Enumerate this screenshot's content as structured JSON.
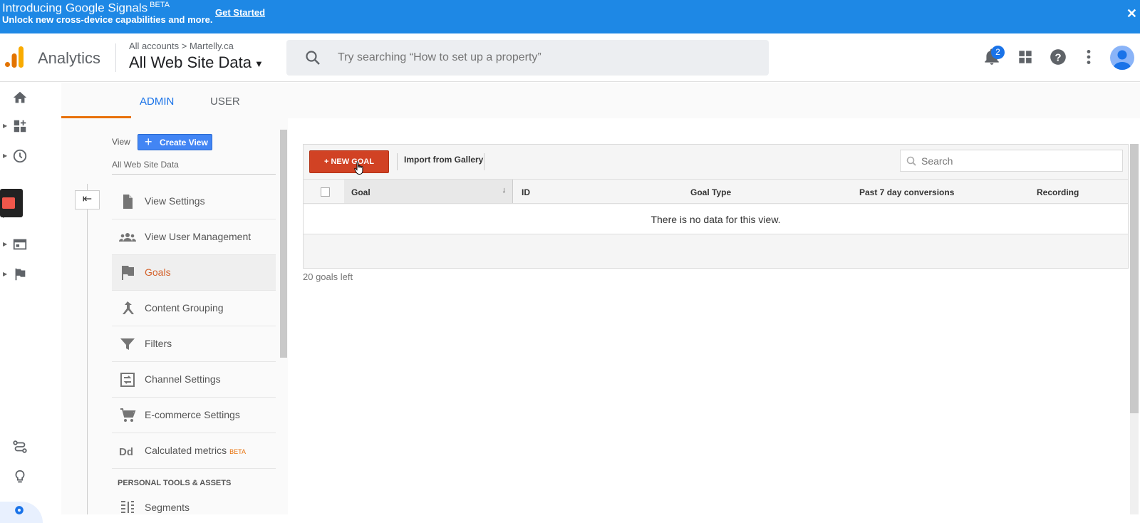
{
  "banner": {
    "title": "Introducing Google Signals",
    "title_sup": "BETA",
    "subtitle": "Unlock new cross-device capabilities and more.",
    "link": "Get Started",
    "close": "✕"
  },
  "header": {
    "app_name": "Analytics",
    "breadcrumb_accounts": "All accounts",
    "breadcrumb_sep": ">",
    "breadcrumb_account": "Martelly.ca",
    "property": "All Web Site Data",
    "search_placeholder": "Try searching “How to set up a property”",
    "notification_count": "2"
  },
  "tabs": {
    "admin": "ADMIN",
    "user": "USER"
  },
  "view_panel": {
    "view_label": "View",
    "create_view": "Create View",
    "view_name": "All Web Site Data",
    "items": [
      {
        "label": "View Settings"
      },
      {
        "label": "View User Management"
      },
      {
        "label": "Goals"
      },
      {
        "label": "Content Grouping"
      },
      {
        "label": "Filters"
      },
      {
        "label": "Channel Settings"
      },
      {
        "label": "E-commerce Settings"
      },
      {
        "label": "Calculated metrics",
        "badge": "BETA"
      }
    ],
    "section_header": "PERSONAL TOOLS & ASSETS",
    "segments": "Segments"
  },
  "goals": {
    "new_goal": "+ NEW GOAL",
    "import": "Import from Gallery",
    "search_placeholder": "Search",
    "columns": {
      "goal": "Goal",
      "id": "ID",
      "type": "Goal Type",
      "conversions": "Past 7 day conversions",
      "recording": "Recording"
    },
    "empty": "There is no data for this view.",
    "goals_left": "20 goals left"
  },
  "colors": {
    "banner_bg": "#1e88e5",
    "accent_blue": "#1a73e8",
    "new_goal_red": "#d14224",
    "active_orange": "#d4622b"
  }
}
